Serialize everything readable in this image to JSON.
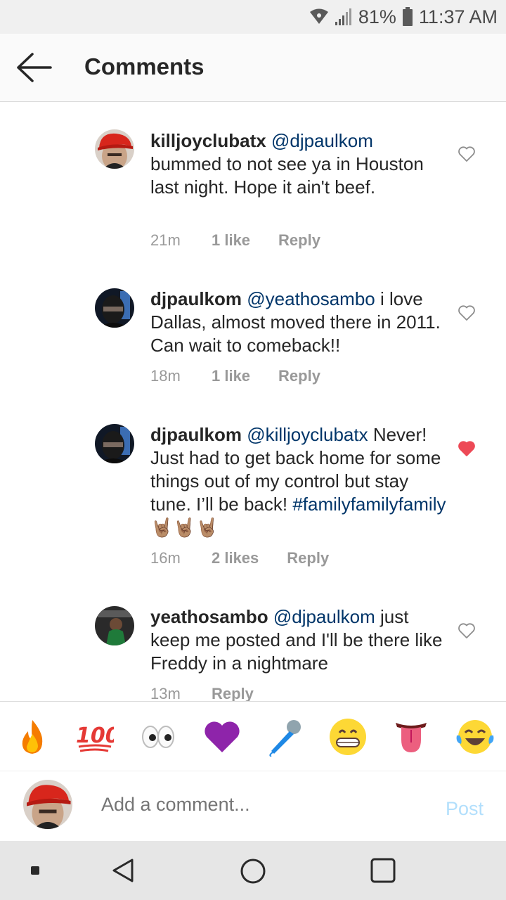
{
  "status": {
    "battery": "81%",
    "time": "11:37 AM"
  },
  "header": {
    "title": "Comments"
  },
  "comments": [
    {
      "user": "killjoyclubatx",
      "mention": "@djpaulkom",
      "text": " bummed to not see ya in Houston last night. Hope it ain't beef.",
      "hashtag": "",
      "emojis": "",
      "time": "21m",
      "likes": "1 like",
      "reply": "Reply",
      "liked": false
    },
    {
      "user": "djpaulkom",
      "mention": "@yeathosambo",
      "text": " i love Dallas, almost moved there in 2011. Can wait to comeback!!",
      "hashtag": "",
      "emojis": "",
      "time": "18m",
      "likes": "1 like",
      "reply": "Reply",
      "liked": false
    },
    {
      "user": "djpaulkom",
      "mention": "@killjoyclubatx",
      "text": " Never! Just had to get back home for some things out of my control but stay tune. I’ll be back! ",
      "hashtag": "#familyfamilyfamily",
      "emojis": " 🤘🏽🤘🏽🤘🏽",
      "time": "16m",
      "likes": "2 likes",
      "reply": "Reply",
      "liked": true
    },
    {
      "user": "yeathosambo",
      "mention": "@djpaulkom",
      "text": " just keep me posted and I'll be there like Freddy in a nightmare",
      "hashtag": "",
      "emojis": "",
      "time": "13m",
      "likes": "",
      "reply": "Reply",
      "liked": false
    }
  ],
  "emoji_bar": [
    "fire-emoji",
    "hundred-emoji",
    "eyes-emoji",
    "purple-heart-emoji",
    "microphone-emoji",
    "grin-emoji",
    "tongue-emoji",
    "joy-emoji"
  ],
  "composer": {
    "placeholder": "Add a comment...",
    "post_label": "Post"
  },
  "colors": {
    "mention": "#003569",
    "liked_heart": "#ed4956",
    "post_disabled": "#b2dffc"
  }
}
